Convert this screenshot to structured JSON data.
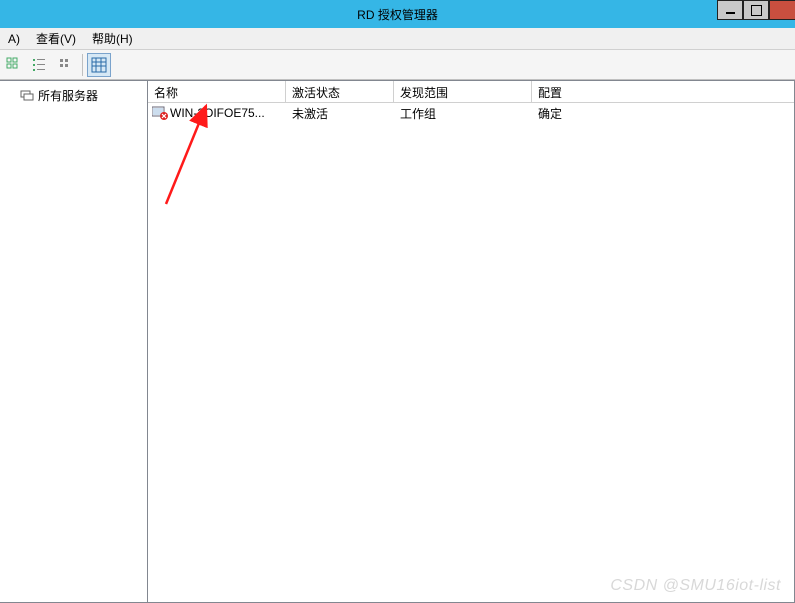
{
  "window": {
    "title": "RD 授权管理器"
  },
  "menu": {
    "action": "A)",
    "view": "查看(V)",
    "help": "帮助(H)"
  },
  "sidebar": {
    "all_servers": "所有服务器"
  },
  "columns": {
    "name": "名称",
    "activation_status": "激活状态",
    "discovery_scope": "发现范围",
    "configuration": "配置"
  },
  "rows": [
    {
      "name": "WIN-2OIFOE75...",
      "status": "未激活",
      "scope": "工作组",
      "config": "确定"
    }
  ],
  "watermark": "CSDN @SMU16iot-list"
}
